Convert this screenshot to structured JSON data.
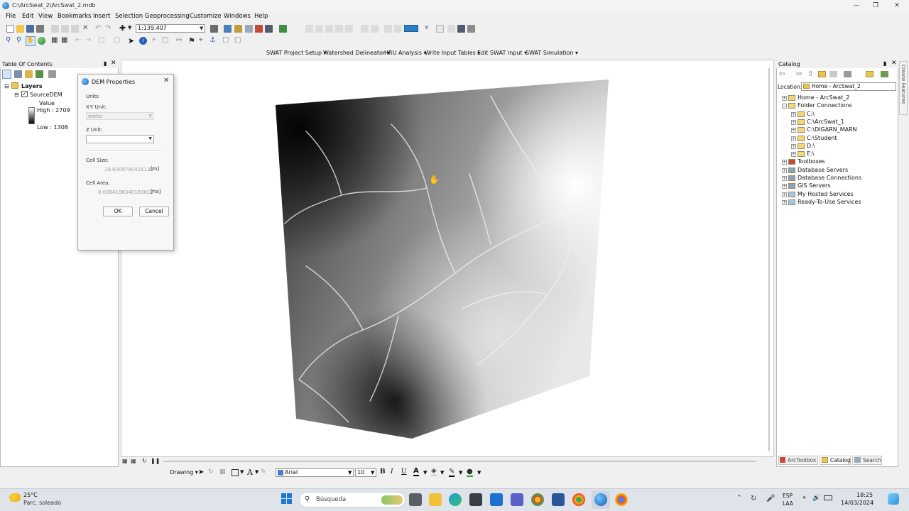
{
  "window": {
    "title": "C:\\ArcSwat_2\\ArcSwat_2.mdb"
  },
  "menu": [
    "File",
    "Edit",
    "View",
    "Bookmarks",
    "Insert",
    "Selection",
    "Geoprocessing",
    "Customize",
    "Windows",
    "Help"
  ],
  "standard_toolbar": {
    "scale": "1:139.407"
  },
  "swat_toolbar": [
    "SWAT Project Setup",
    "Watershed Delineator",
    "HRU Analysis",
    "Write Input Tables",
    "Edit SWAT Input",
    "SWAT Simulation"
  ],
  "toc": {
    "title": "Table Of Contents",
    "layers_label": "Layers",
    "layer_name": "SourceDEM",
    "legend_value_label": "Value",
    "legend_high": "High : 2709",
    "legend_low": "Low : 1308"
  },
  "dialog": {
    "title": "DEM Properties",
    "units_label": "Units",
    "xy_unit_label": "X-Y Unit:",
    "xy_unit_value": "meter",
    "z_unit_label": "Z Unit:",
    "z_unit_value": "",
    "cell_size_label": "Cell Size:",
    "cell_size_value": "19.6009780415139",
    "cell_size_unit": "[m]",
    "cell_area_label": "Cell Area:",
    "cell_area_value": "0.0384198340183812",
    "cell_area_unit": "[ha]",
    "ok": "OK",
    "cancel": "Cancel"
  },
  "catalog": {
    "title": "Catalog",
    "location_label": "Location:",
    "location_value": "Home - ArcSwat_2",
    "tree": [
      "Home - ArcSwat_2",
      "Folder Connections",
      "C:\\",
      "C:\\ArcSwat_1",
      "C:\\DIGARN_MARN",
      "C:\\Student",
      "D:\\",
      "E:\\",
      "Toolboxes",
      "Database Servers",
      "Database Connections",
      "GIS Servers",
      "My Hosted Services",
      "Ready-To-Use Services"
    ],
    "tabs": [
      "ArcToolbox",
      "Catalog",
      "Search"
    ],
    "side_tab": "Create Features"
  },
  "drawbar": {
    "drawing": "Drawing",
    "font": "Arial",
    "size": "10",
    "bold": "B",
    "italic": "I",
    "underline": "U",
    "font_color": "A"
  },
  "taskbar": {
    "weather_temp": "25°C",
    "weather_text": "Parc. soleado",
    "search_placeholder": "Búsqueda",
    "lang1": "ESP",
    "lang2": "LAA",
    "time": "18:25",
    "date": "14/03/2024"
  }
}
